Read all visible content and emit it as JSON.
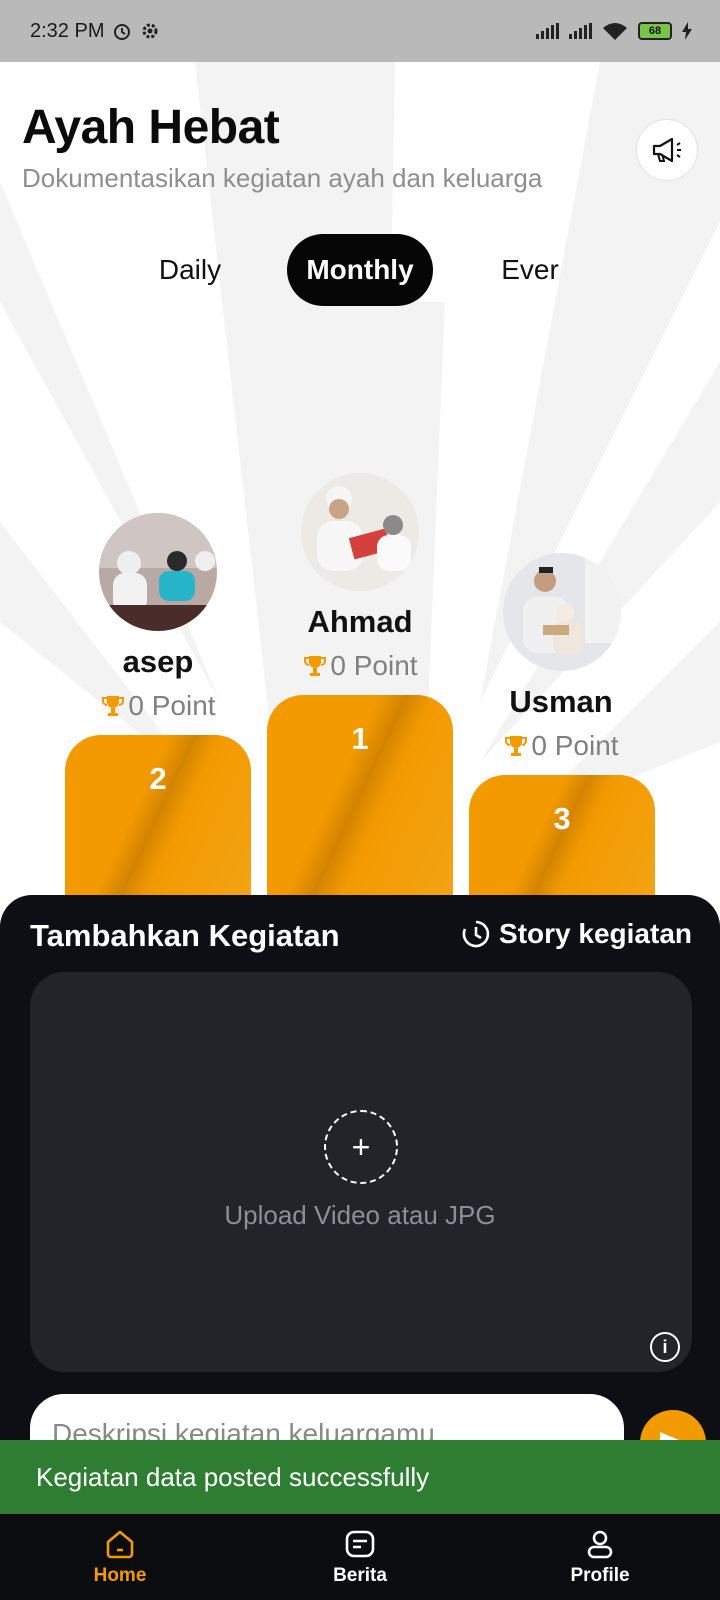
{
  "status_bar": {
    "time": "2:32 PM",
    "battery": "68"
  },
  "header": {
    "title": "Ayah Hebat",
    "subtitle": "Dokumentasikan kegiatan ayah dan keluarga"
  },
  "tabs": [
    {
      "label": "Daily",
      "active": false
    },
    {
      "label": "Monthly",
      "active": true
    },
    {
      "label": "Ever",
      "active": false
    }
  ],
  "leaderboard": [
    {
      "rank": "2",
      "name": "asep",
      "points": "0 Point"
    },
    {
      "rank": "1",
      "name": "Ahmad",
      "points": "0 Point"
    },
    {
      "rank": "3",
      "name": "Usman",
      "points": "0 Point"
    }
  ],
  "activity": {
    "title": "Tambahkan Kegiatan",
    "story_link": "Story kegiatan",
    "upload_label": "Upload Video atau JPG",
    "description_placeholder": "Deskripsi kegiatan keluargamu"
  },
  "toast": "Kegiatan data posted successfully",
  "nav": [
    {
      "label": "Home",
      "icon": "home-icon",
      "active": true
    },
    {
      "label": "Berita",
      "icon": "news-icon",
      "active": false
    },
    {
      "label": "Profile",
      "icon": "profile-icon",
      "active": false
    }
  ],
  "colors": {
    "accent": "#f39a00",
    "panel": "#0d0f14",
    "toast": "#2e7d32"
  }
}
